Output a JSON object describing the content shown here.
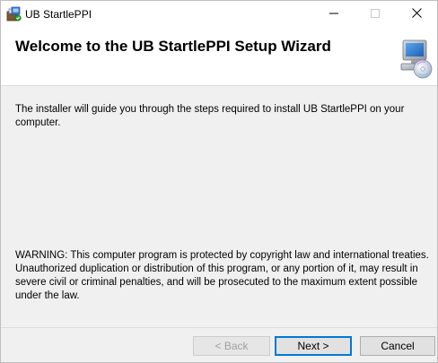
{
  "window": {
    "title": "UB StartlePPI",
    "icon": "installer-icon",
    "controls": {
      "minimize_icon": "minimize-icon",
      "maximize_icon": "maximize-icon",
      "close_icon": "close-icon"
    }
  },
  "header": {
    "title": "Welcome to the UB StartlePPI Setup Wizard",
    "art_icon": "computer-cd-icon"
  },
  "body": {
    "intro": "The installer will guide you through the steps required to install UB StartlePPI on your computer.",
    "warning": "WARNING: This computer program is protected by copyright law and international treaties. Unauthorized duplication or distribution of this program, or any portion of it, may result in severe civil or criminal penalties, and will be prosecuted to the maximum extent possible under the law."
  },
  "buttons": {
    "back": "< Back",
    "next": "Next >",
    "cancel": "Cancel"
  },
  "colors": {
    "accent": "#0078d7",
    "window_background": "#f0f0f0",
    "disabled_text": "#a0a0a0"
  }
}
